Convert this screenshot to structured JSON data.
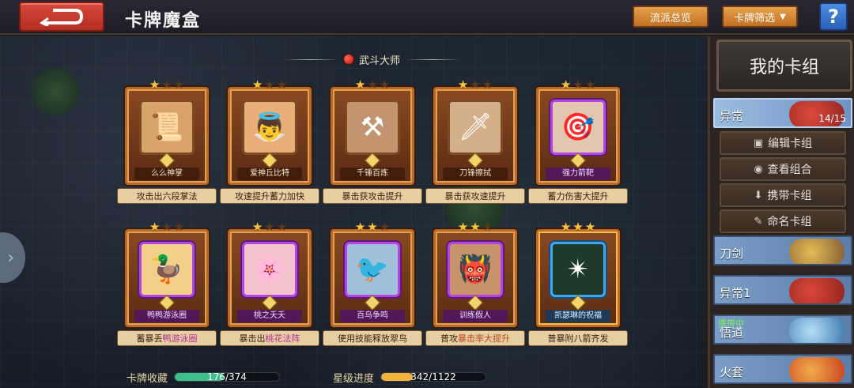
{
  "header": {
    "title": "卡牌魔盒",
    "school_overview": "流派总览",
    "card_filter": "卡牌筛选",
    "help": "?"
  },
  "section": {
    "title": "武斗大师"
  },
  "cards": [
    {
      "name": "么么神掌",
      "desc_pre": "攻击出六段掌法",
      "desc_hl": "",
      "desc_post": "",
      "stars": 1,
      "rarity": "normal",
      "icon": "scroll-icon",
      "glyph": "📜"
    },
    {
      "name": "爱神丘比特",
      "desc_pre": "攻速提升蓄力加快",
      "desc_hl": "",
      "desc_post": "",
      "stars": 1,
      "rarity": "normal",
      "icon": "cupid-icon",
      "glyph": "👼"
    },
    {
      "name": "千锤百炼",
      "desc_pre": "暴击获攻击提升",
      "desc_hl": "",
      "desc_post": "",
      "stars": 1,
      "rarity": "normal",
      "icon": "anvil-icon",
      "glyph": "⚒"
    },
    {
      "name": "刀锋擦拭",
      "desc_pre": "暴击获攻速提升",
      "desc_hl": "",
      "desc_post": "",
      "stars": 1,
      "rarity": "normal",
      "icon": "blade-wipe-icon",
      "glyph": "🗡"
    },
    {
      "name": "强力箭靶",
      "desc_pre": "蓄力伤害大提升",
      "desc_hl": "",
      "desc_post": "",
      "stars": 1,
      "rarity": "purple",
      "icon": "target-icon",
      "glyph": "🎯"
    },
    {
      "name": "鸭鸭游泳圈",
      "desc_pre": "蓄暴丢",
      "desc_hl": "鸭游泳圈",
      "desc_post": "",
      "stars": 1,
      "rarity": "purple",
      "icon": "duck-ring-icon",
      "glyph": "🦆"
    },
    {
      "name": "桃之夭夭",
      "desc_pre": "暴击出",
      "desc_hl": "桃花法阵",
      "desc_post": "",
      "stars": 1,
      "rarity": "purple",
      "icon": "peach-blossom-icon",
      "glyph": "🌸"
    },
    {
      "name": "百鸟争鸣",
      "desc_pre": "使用技能释放翠鸟",
      "desc_hl": "",
      "desc_post": "",
      "stars": 2,
      "rarity": "purple",
      "icon": "kingfisher-icon",
      "glyph": "🐦"
    },
    {
      "name": "训练假人",
      "desc_pre": "普攻",
      "desc_hl2": "暴击率大提升",
      "desc_hl": "",
      "desc_post": "",
      "stars": 2,
      "rarity": "purple",
      "icon": "dummy-icon",
      "glyph": "👹"
    },
    {
      "name": "凯瑟琳的祝福",
      "desc_pre": "普暴附八箭齐发",
      "desc_hl": "",
      "desc_post": "",
      "stars": 3,
      "rarity": "blue",
      "icon": "blessing-icon",
      "glyph": "✴"
    }
  ],
  "progress": {
    "collection_label": "卡牌收藏",
    "collection_value": "176/374",
    "collection_fraction": 0.47,
    "star_label": "星级进度",
    "star_value": "342/1122",
    "star_fraction": 0.3
  },
  "deck_panel": {
    "title": "我的卡组",
    "active_deck": {
      "name": "异常",
      "count": "14/15"
    },
    "actions": [
      {
        "label": "编辑卡组",
        "icon": "edit-deck-icon",
        "glyph": "▣"
      },
      {
        "label": "查看组合",
        "icon": "eye-icon",
        "glyph": "◉"
      },
      {
        "label": "携带卡组",
        "icon": "carry-icon",
        "glyph": "⬇"
      },
      {
        "label": "命名卡组",
        "icon": "pencil-icon",
        "glyph": "✎"
      }
    ],
    "decks": [
      {
        "name": "刀剑",
        "carry": ""
      },
      {
        "name": "异常1",
        "carry": ""
      },
      {
        "name": "悟道",
        "carry": "携带中"
      },
      {
        "name": "火套",
        "carry": ""
      }
    ]
  },
  "colors": {
    "collection_bar": "#3fc08a",
    "star_bar": "#f0b43a"
  }
}
